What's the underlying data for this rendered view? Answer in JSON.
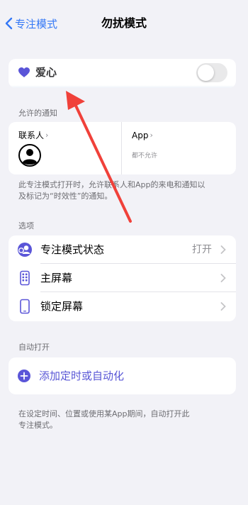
{
  "nav": {
    "back_label": "专注模式",
    "title": "勿扰模式"
  },
  "love": {
    "label": "爱心",
    "icon": "heart-icon",
    "enabled": false
  },
  "allowed": {
    "header": "允许的通知",
    "contacts_label": "联系人",
    "app_label": "App",
    "app_sub": "都不允许",
    "footnote_line1": "此专注模式打开时，允许联系人和App的来电和通知以",
    "footnote_line2": "及标记为“时效性”的通知。"
  },
  "options": {
    "header": "选项",
    "rows": [
      {
        "label": "专注模式状态",
        "value": "打开",
        "icon": "focus-status-icon"
      },
      {
        "label": "主屏幕",
        "value": "",
        "icon": "home-screen-icon"
      },
      {
        "label": "锁定屏幕",
        "value": "",
        "icon": "lock-screen-icon"
      }
    ]
  },
  "auto": {
    "header": "自动打开",
    "add_label": "添加定时或自动化",
    "footnote_line1": "在设定时间、位置或使用某App期间，自动打开此",
    "footnote_line2": "专注模式。"
  },
  "colors": {
    "accent_blue": "#3478f6",
    "accent_purple": "#5856d6",
    "annotation_red": "#f0413a",
    "background": "#f2f2f7"
  }
}
